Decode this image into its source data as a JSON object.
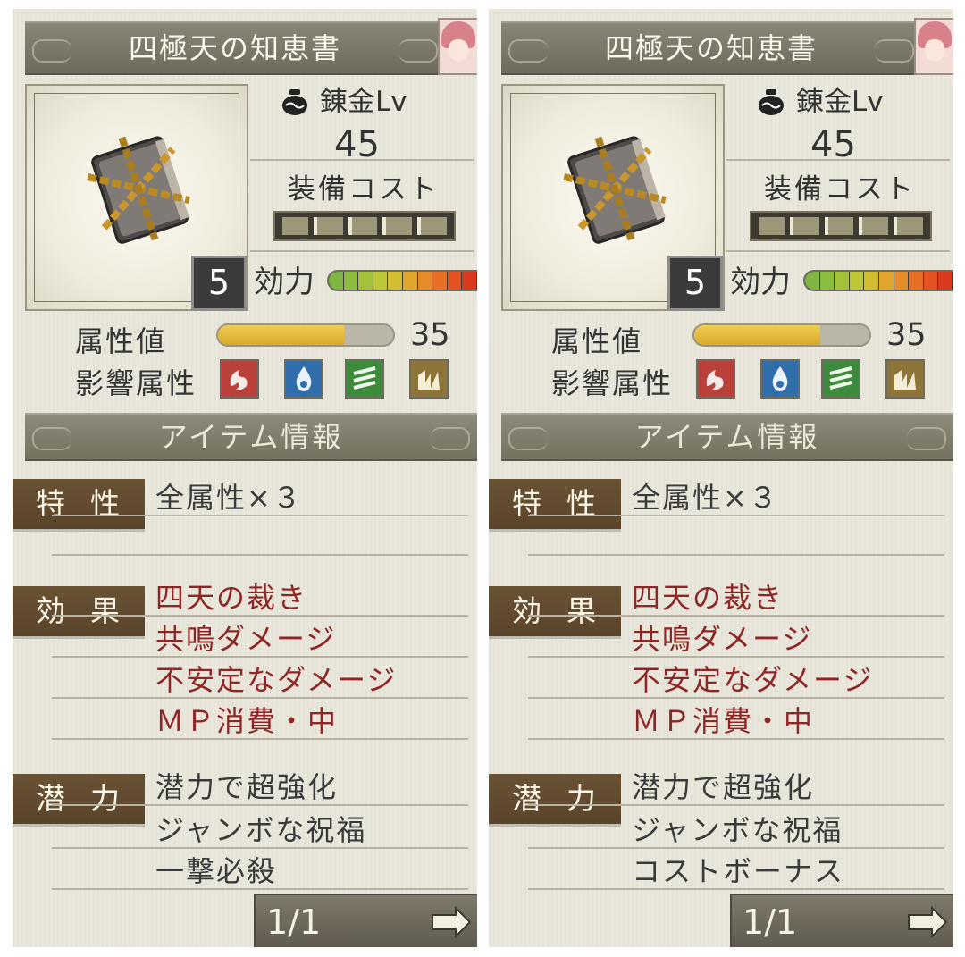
{
  "panels": [
    {
      "title": "四極天の知恵書",
      "quality_level": "5",
      "alchemy_label": "錬金Lv",
      "alchemy_value": "45",
      "cost_label": "装備コスト",
      "effect_label": "効力",
      "attr_label": "属性値",
      "attr_value": "35",
      "attr_fill_ratio": 0.72,
      "affect_label": "影響属性",
      "elements": [
        "fire-icon",
        "water-icon",
        "wind-icon",
        "earth-icon"
      ],
      "info_header": "アイテム情報",
      "traits_tag": "特性",
      "traits": [
        "全属性×３"
      ],
      "effects_tag": "効果",
      "effects": [
        "四天の裁き",
        "共鳴ダメージ",
        "不安定なダメージ",
        "ＭＰ消費・中"
      ],
      "potential_tag": "潜力",
      "potentials": [
        "潜力で超強化",
        "ジャンボな祝福",
        "一撃必殺"
      ],
      "page": "1/1"
    },
    {
      "title": "四極天の知恵書",
      "quality_level": "5",
      "alchemy_label": "錬金Lv",
      "alchemy_value": "45",
      "cost_label": "装備コスト",
      "effect_label": "効力",
      "attr_label": "属性値",
      "attr_value": "35",
      "attr_fill_ratio": 0.72,
      "affect_label": "影響属性",
      "elements": [
        "fire-icon",
        "water-icon",
        "wind-icon",
        "earth-icon"
      ],
      "info_header": "アイテム情報",
      "traits_tag": "特性",
      "traits": [
        "全属性×３"
      ],
      "effects_tag": "効果",
      "effects": [
        "四天の裁き",
        "共鳴ダメージ",
        "不安定なダメージ",
        "ＭＰ消費・中"
      ],
      "potential_tag": "潜力",
      "potentials": [
        "潜力で超強化",
        "ジャンボな祝福",
        "コストボーナス"
      ],
      "page": "1/1"
    }
  ],
  "colors": {
    "effect_text": "#8e2626",
    "tag_bg": "#5f4830",
    "attr_fill": "#e1b43a",
    "fire": "#b9403b",
    "water": "#2f6eab",
    "wind": "#3d8a3c",
    "earth": "#8d7438"
  }
}
